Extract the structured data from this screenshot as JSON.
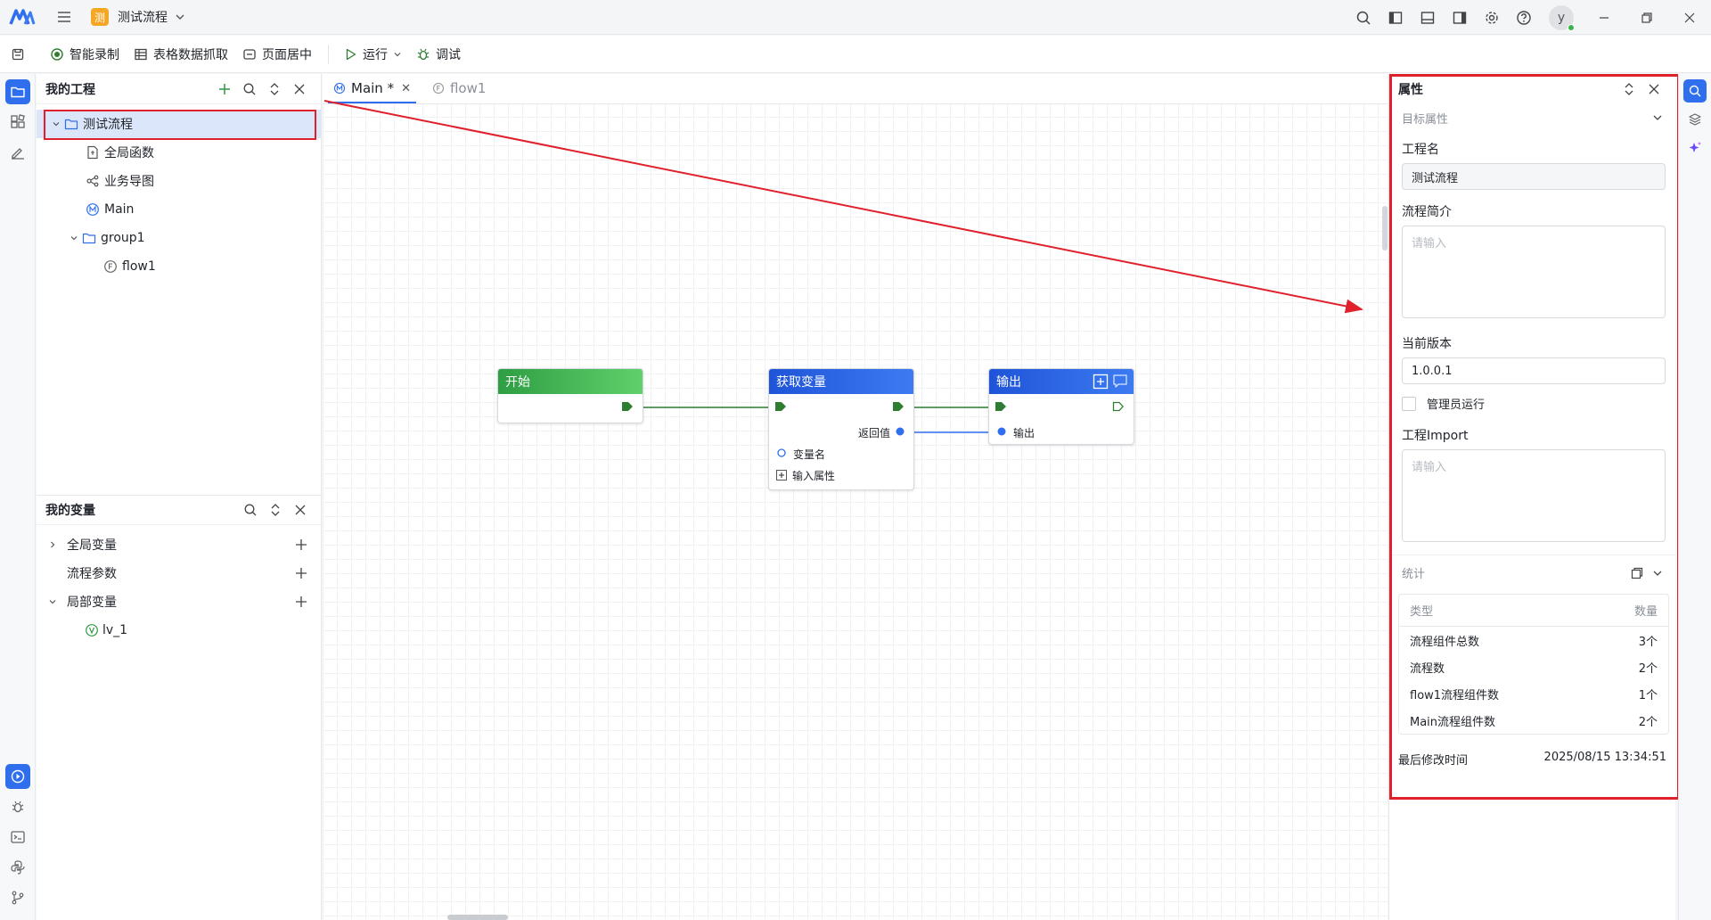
{
  "titlebar": {
    "project_badge": "测",
    "project_name": "测试流程"
  },
  "toolbar": {
    "smart_record": "智能录制",
    "table_scrape": "表格数据抓取",
    "page_center": "页面居中",
    "run": "运行",
    "debug": "调试"
  },
  "project_panel": {
    "title": "我的工程",
    "tree": [
      {
        "label": "测试流程",
        "icon": "folder-icon"
      },
      {
        "label": "全局函数",
        "icon": "function-file-icon"
      },
      {
        "label": "业务导图",
        "icon": "mindmap-icon"
      },
      {
        "label": "Main",
        "icon": "main-flow-icon"
      },
      {
        "label": "group1",
        "icon": "folder-icon"
      },
      {
        "label": "flow1",
        "icon": "flow-icon"
      }
    ]
  },
  "variables_panel": {
    "title": "我的变量",
    "rows": [
      {
        "label": "全局变量"
      },
      {
        "label": "流程参数"
      },
      {
        "label": "局部变量"
      },
      {
        "label": "lv_1"
      }
    ]
  },
  "tabs": [
    {
      "label": "Main *",
      "active": true
    },
    {
      "label": "flow1",
      "active": false
    }
  ],
  "canvas": {
    "nodes": {
      "start": {
        "title": "开始"
      },
      "get_var": {
        "title": "获取变量",
        "return_label": "返回值",
        "var_name_label": "变量名",
        "input_attr_label": "输入属性"
      },
      "output": {
        "title": "输出",
        "output_label": "输出"
      }
    }
  },
  "properties": {
    "title": "属性",
    "section_target": "目标属性",
    "project_name_label": "工程名",
    "project_name_value": "测试流程",
    "description_label": "流程简介",
    "description_placeholder": "请输入",
    "version_label": "当前版本",
    "version_value": "1.0.0.1",
    "admin_run_label": "管理员运行",
    "import_label": "工程Import",
    "import_placeholder": "请输入",
    "stats_label": "统计",
    "stats_header": {
      "type": "类型",
      "count": "数量"
    },
    "stats_rows": [
      {
        "name": "流程组件总数",
        "count": "3个"
      },
      {
        "name": "流程数",
        "count": "2个"
      },
      {
        "name": "flow1流程组件数",
        "count": "1个"
      },
      {
        "name": "Main流程组件数",
        "count": "2个"
      }
    ],
    "modified_label": "最后修改时间",
    "modified_value": "2025/08/15 13:34:51"
  },
  "user": {
    "avatar_letter": "y"
  },
  "colors": {
    "accent": "#2f6fed",
    "annotation_red": "#e0202a",
    "node_green": "#2f9e44",
    "node_blue": "#1f54d8",
    "badge_orange": "#f5a623"
  }
}
